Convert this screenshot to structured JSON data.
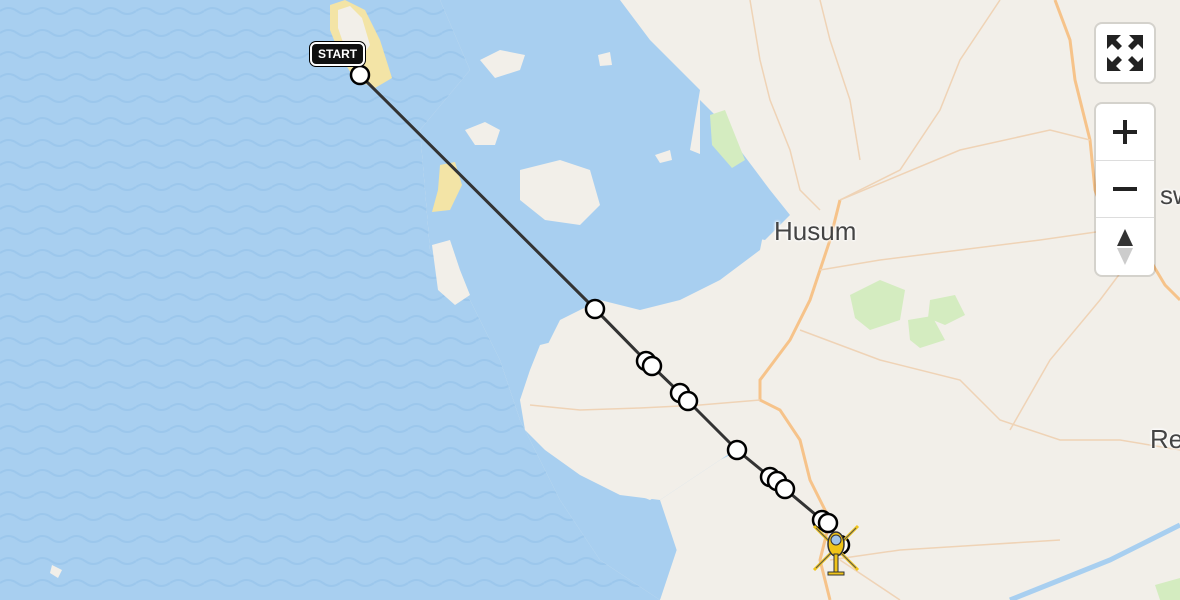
{
  "map": {
    "places": [
      {
        "name": "Husum"
      },
      {
        "name": "Re"
      },
      {
        "name": "sw"
      }
    ],
    "route": {
      "start_label": "START",
      "colors": {
        "line": "#333333",
        "waypoint_fill": "#ffffff",
        "waypoint_stroke": "#000000"
      }
    },
    "colors": {
      "water": "#a8cff0",
      "land": "#f2efe9",
      "sand": "#f3e4a6",
      "green": "#d4ecc0",
      "road": "#f6c38a"
    },
    "destination_icon": "helicopter-icon"
  },
  "controls": {
    "fullscreen_icon": "fullscreen-icon",
    "zoom_in_icon": "zoom-in-icon",
    "zoom_out_icon": "zoom-out-icon",
    "compass_icon": "compass-icon"
  }
}
